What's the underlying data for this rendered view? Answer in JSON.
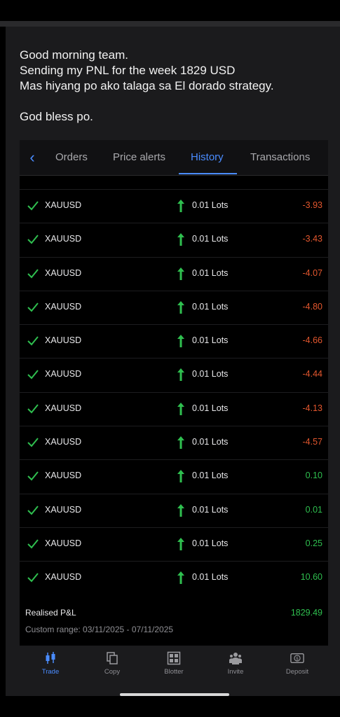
{
  "message": {
    "line1": "Good morning team.",
    "line2": "Sending my PNL for the week 1829 USD",
    "line3": "Mas hiyang po ako talaga sa El dorado strategy.",
    "line4": "God bless po."
  },
  "tabs": [
    "Orders",
    "Price alerts",
    "History",
    "Transactions"
  ],
  "active_tab": "History",
  "history": [
    {
      "symbol": "XAUUSD",
      "lots": "0.01 Lots",
      "pnl": "-3.93"
    },
    {
      "symbol": "XAUUSD",
      "lots": "0.01 Lots",
      "pnl": "-3.43"
    },
    {
      "symbol": "XAUUSD",
      "lots": "0.01 Lots",
      "pnl": "-4.07"
    },
    {
      "symbol": "XAUUSD",
      "lots": "0.01 Lots",
      "pnl": "-4.80"
    },
    {
      "symbol": "XAUUSD",
      "lots": "0.01 Lots",
      "pnl": "-4.66"
    },
    {
      "symbol": "XAUUSD",
      "lots": "0.01 Lots",
      "pnl": "-4.44"
    },
    {
      "symbol": "XAUUSD",
      "lots": "0.01 Lots",
      "pnl": "-4.13"
    },
    {
      "symbol": "XAUUSD",
      "lots": "0.01 Lots",
      "pnl": "-4.57"
    },
    {
      "symbol": "XAUUSD",
      "lots": "0.01 Lots",
      "pnl": "0.10"
    },
    {
      "symbol": "XAUUSD",
      "lots": "0.01 Lots",
      "pnl": "0.01"
    },
    {
      "symbol": "XAUUSD",
      "lots": "0.01 Lots",
      "pnl": "0.25"
    },
    {
      "symbol": "XAUUSD",
      "lots": "0.01 Lots",
      "pnl": "10.60"
    }
  ],
  "summary": {
    "label": "Realised P&L",
    "value": "1829.49",
    "range": "Custom range: 03/11/2025 - 07/11/2025"
  },
  "nav": [
    {
      "label": "Trade",
      "icon": "candlestick-icon"
    },
    {
      "label": "Copy",
      "icon": "copy-icon"
    },
    {
      "label": "Blotter",
      "icon": "blotter-icon"
    },
    {
      "label": "Invite",
      "icon": "people-icon"
    },
    {
      "label": "Deposit",
      "icon": "deposit-icon"
    }
  ],
  "colors": {
    "accent": "#4a8cff",
    "positive": "#2fbf4f",
    "negative": "#e4572e"
  }
}
